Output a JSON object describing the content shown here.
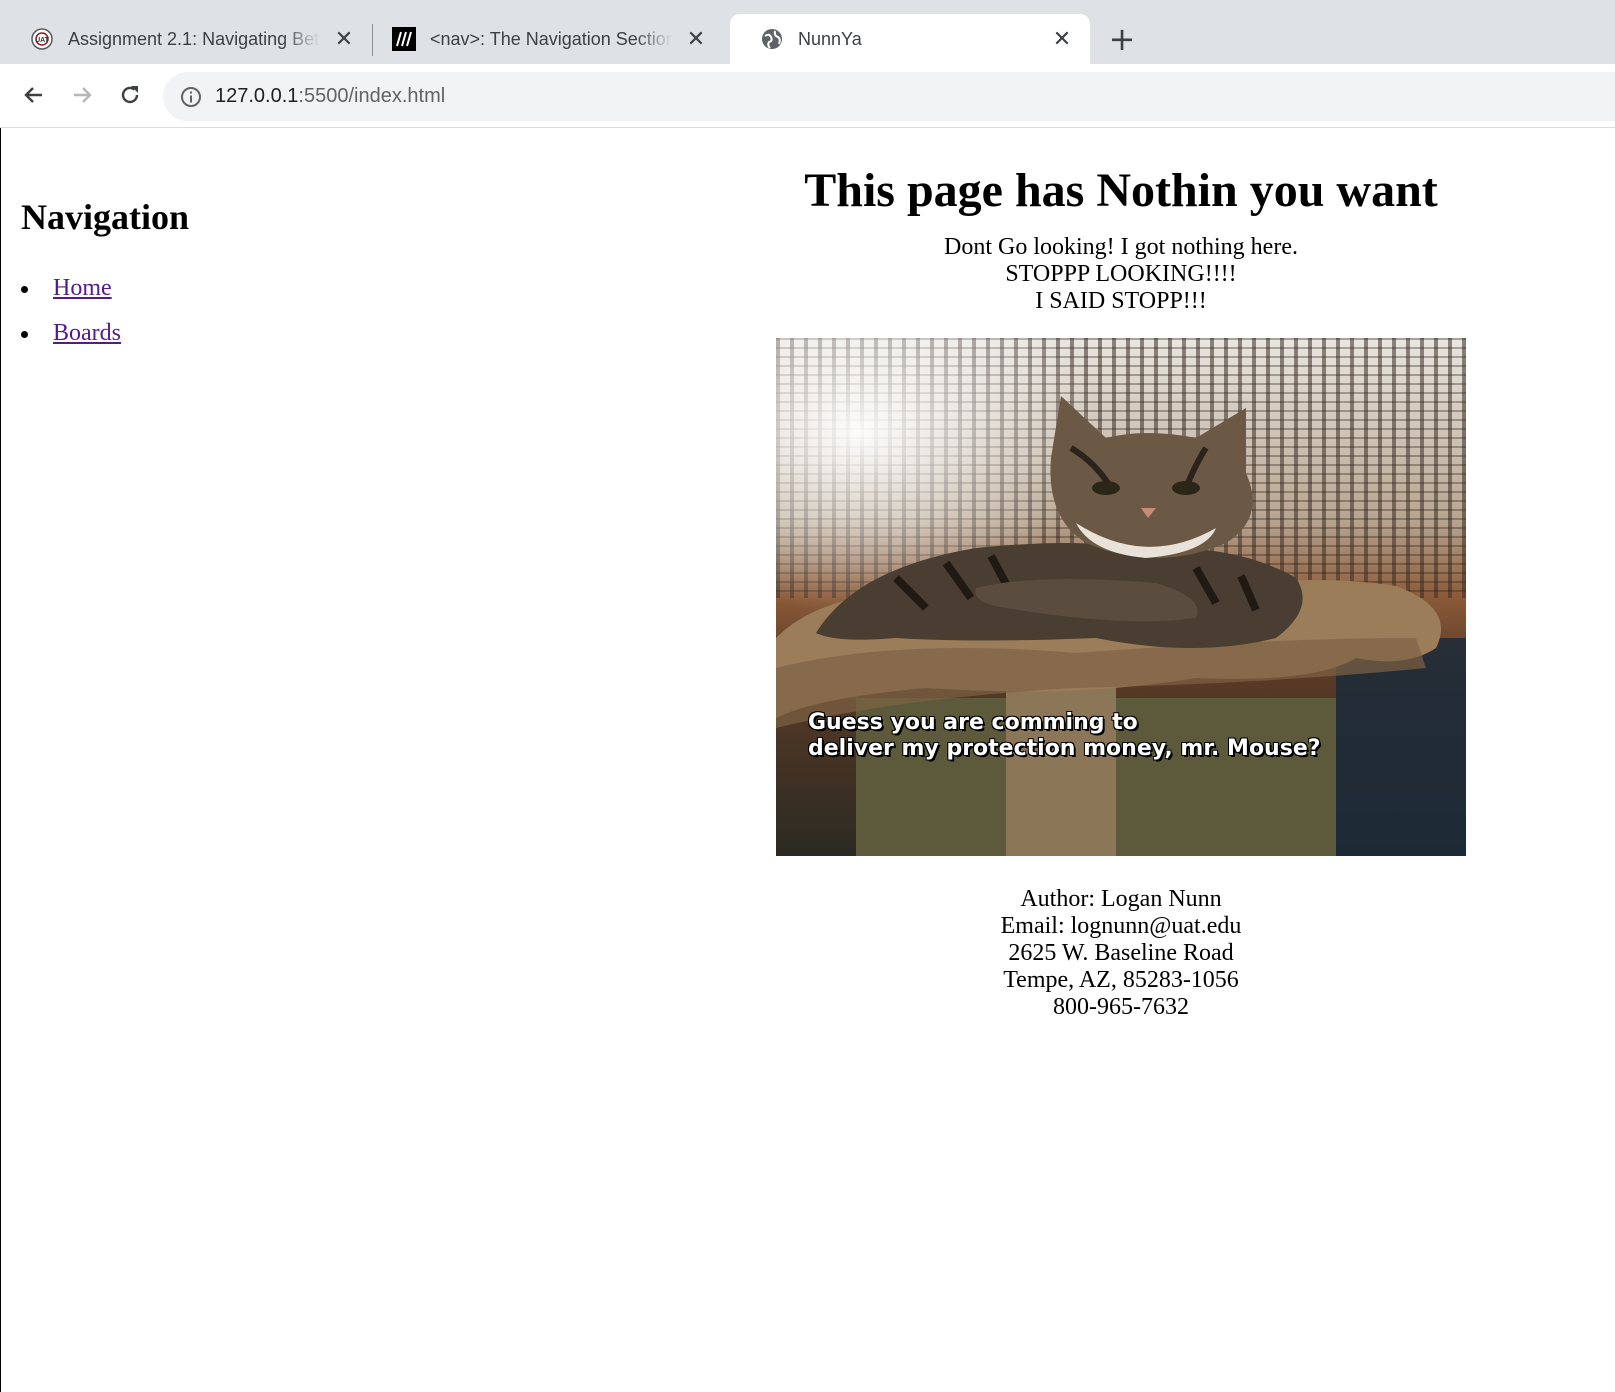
{
  "browser": {
    "tabs": [
      {
        "title": "Assignment 2.1: Navigating Between Pages",
        "icon": "uat-logo-icon",
        "active": false
      },
      {
        "title": "<nav>: The Navigation Section element",
        "icon": "mdn-logo-icon",
        "active": false
      },
      {
        "title": "NunnYa",
        "icon": "globe-icon",
        "active": true
      }
    ],
    "address": {
      "host": "127.0.0.1",
      "path": ":5500/index.html"
    }
  },
  "nav": {
    "heading": "Navigation",
    "links": [
      "Home",
      "Boards"
    ]
  },
  "main": {
    "title": "This page has Nothin you want",
    "intro_lines": [
      "Dont Go looking! I got nothing here.",
      "STOPPP LOOKING!!!!",
      "I SAID STOPP!!!"
    ],
    "meme": {
      "caption_lines": [
        "Guess you are comming to",
        "deliver my protection money, mr. Mouse?"
      ]
    },
    "contact_lines": [
      "Author: Logan Nunn",
      "Email: lognunn@uat.edu",
      "2625 W. Baseline Road",
      "Tempe, AZ, 85283-1056",
      "800-965-7632"
    ]
  },
  "colors": {
    "visited_link": "#551a8b",
    "tabstrip": "#dee1e6",
    "omnibox": "#f1f3f4"
  }
}
